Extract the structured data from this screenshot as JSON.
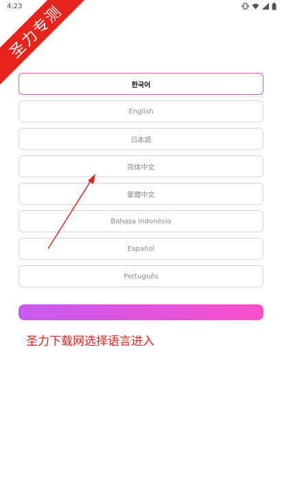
{
  "status_bar": {
    "time": "4:23",
    "icons": [
      "vibrate-icon",
      "wifi-icon",
      "signal-icon",
      "battery-icon"
    ]
  },
  "watermark": {
    "text": "圣力专测",
    "color": "#e8231b"
  },
  "languages": [
    {
      "label": "한국어",
      "selected": true
    },
    {
      "label": "English",
      "selected": false
    },
    {
      "label": "日本語",
      "selected": false
    },
    {
      "label": "简体中文",
      "selected": false
    },
    {
      "label": "繁體中文",
      "selected": false
    },
    {
      "label": "Bahasa Indonésia",
      "selected": false
    },
    {
      "label": "Español",
      "selected": false
    },
    {
      "label": "Português",
      "selected": false
    }
  ],
  "enter_button": {
    "label": "",
    "gradient": [
      "#c65af0",
      "#f94fc9"
    ]
  },
  "annotation": {
    "caption": "圣力下载网选择语言进入",
    "color": "#e8231b"
  },
  "colors": {
    "selected_border": "#d64fd0",
    "item_border": "#d8d8d8",
    "item_text": "#8a8a8a"
  }
}
